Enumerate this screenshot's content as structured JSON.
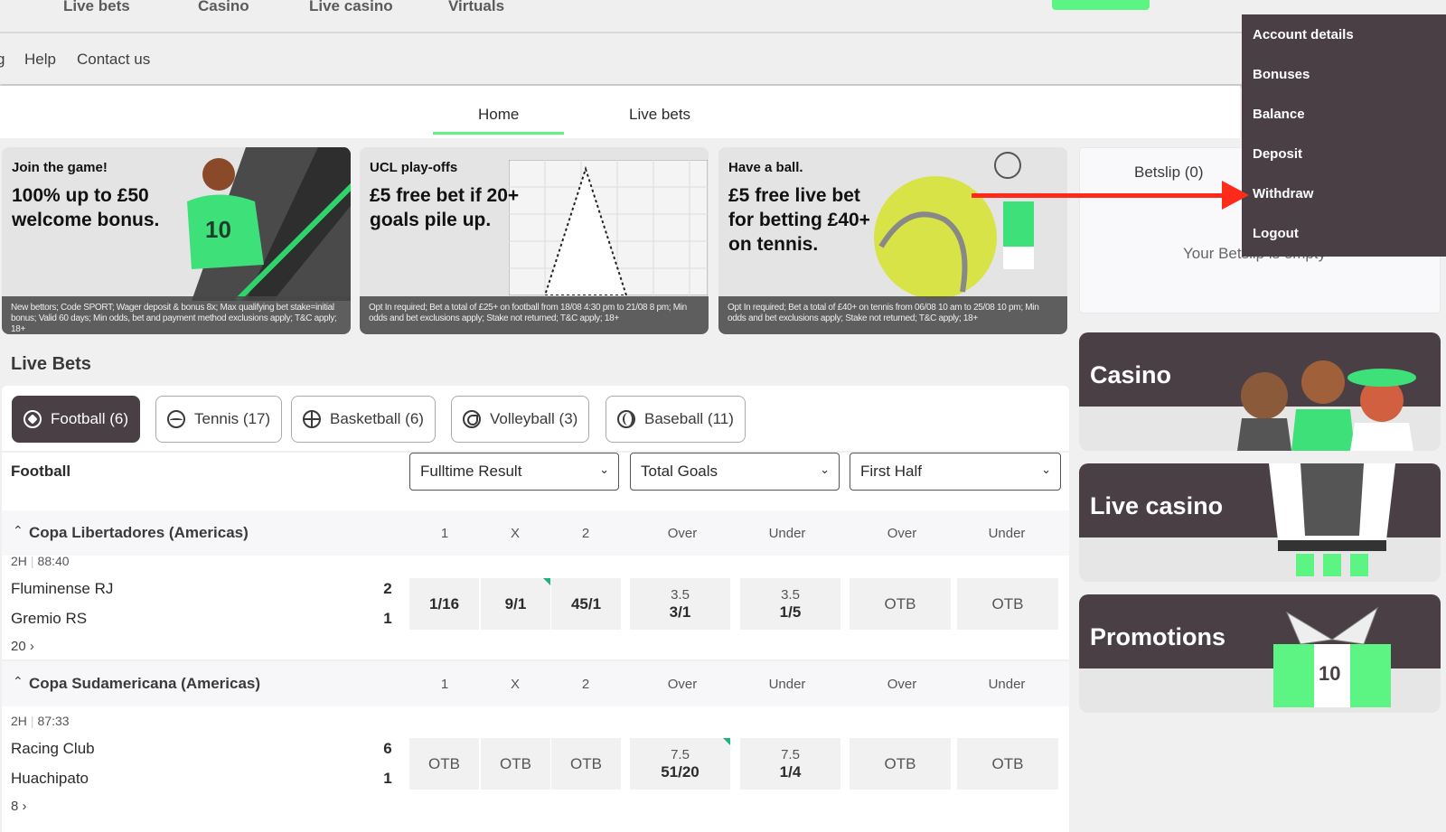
{
  "topnav": {
    "items": [
      "Live bets",
      "Casino",
      "Live casino",
      "Virtuals"
    ]
  },
  "subnav": {
    "partial": "g",
    "items": [
      "Help",
      "Contact us"
    ]
  },
  "pagetabs": [
    {
      "label": "Home",
      "active": true
    },
    {
      "label": "Live bets",
      "active": false
    }
  ],
  "banners": [
    {
      "kicker": "Join the game!",
      "headline": "100% up to £50 welcome bonus.",
      "terms": "New bettors; Code SPORT; Wager deposit & bonus 8x; Max qualifying bet stake=initial bonus; Valid 60 days; Min odds, bet and payment method exclusions apply; T&C apply; 18+"
    },
    {
      "kicker": "UCL play-offs",
      "headline": "£5 free bet if 20+ goals pile up.",
      "terms": "Opt In required; Bet a total of £25+ on football from 18/08 4:30 pm to 21/08 8 pm; Min odds and bet exclusions apply; Stake not returned; T&C apply; 18+"
    },
    {
      "kicker": "Have a ball.",
      "headline": "£5 free live bet for betting £40+ on tennis.",
      "terms": "Opt In required; Bet a total of £40+ on tennis from 06/08 10 am to 25/08 10 pm; Min odds and bet exclusions apply; Stake not returned; T&C apply; 18+"
    }
  ],
  "live": {
    "title": "Live Bets",
    "sports": [
      {
        "label": "Football (6)",
        "icon": "football-icon",
        "active": true
      },
      {
        "label": "Tennis (17)",
        "icon": "tennis-icon",
        "active": false
      },
      {
        "label": "Basketball (6)",
        "icon": "basketball-icon",
        "active": false
      },
      {
        "label": "Volleyball (3)",
        "icon": "volleyball-icon",
        "active": false
      },
      {
        "label": "Baseball (11)",
        "icon": "baseball-icon",
        "active": false
      }
    ],
    "sport_label": "Football",
    "selects": [
      "Fulltime Result",
      "Total Goals",
      "First Half"
    ],
    "columns": [
      "1",
      "X",
      "2",
      "Over",
      "Under",
      "Over",
      "Under"
    ],
    "leagues": [
      {
        "name": "Copa Libertadores (Americas)",
        "match": {
          "period": "2H",
          "clock": "88:40",
          "home": "Fluminense RJ",
          "away": "Gremio RS",
          "home_score": "2",
          "away_score": "1",
          "markets": "20 ›",
          "odds": [
            {
              "line": "",
              "price": "1/16",
              "otb": false
            },
            {
              "line": "",
              "price": "9/1",
              "otb": false,
              "changed": true
            },
            {
              "line": "",
              "price": "45/1",
              "otb": false
            },
            {
              "line": "3.5",
              "price": "3/1",
              "otb": false
            },
            {
              "line": "3.5",
              "price": "1/5",
              "otb": false
            },
            {
              "line": "",
              "price": "OTB",
              "otb": true
            },
            {
              "line": "",
              "price": "OTB",
              "otb": true
            }
          ]
        }
      },
      {
        "name": "Copa Sudamericana (Americas)",
        "match": {
          "period": "2H",
          "clock": "87:33",
          "home": "Racing Club",
          "away": "Huachipato",
          "home_score": "6",
          "away_score": "1",
          "markets": "8 ›",
          "odds": [
            {
              "line": "",
              "price": "OTB",
              "otb": true
            },
            {
              "line": "",
              "price": "OTB",
              "otb": true
            },
            {
              "line": "",
              "price": "OTB",
              "otb": true
            },
            {
              "line": "7.5",
              "price": "51/20",
              "otb": false,
              "changed": true
            },
            {
              "line": "7.5",
              "price": "1/4",
              "otb": false
            },
            {
              "line": "",
              "price": "OTB",
              "otb": true
            },
            {
              "line": "",
              "price": "OTB",
              "otb": true
            }
          ]
        }
      }
    ]
  },
  "betslip": {
    "title": "Betslip (0)",
    "empty": "Your Betslip is empty"
  },
  "promo_cards": [
    "Casino",
    "Live casino",
    "Promotions"
  ],
  "account_menu": [
    "Account details",
    "Bonuses",
    "Balance",
    "Deposit",
    "Withdraw",
    "Logout"
  ],
  "colors": {
    "brand_green": "#5cf584",
    "dark": "#4a3f45",
    "annotation_red": "#ff2a1a"
  }
}
